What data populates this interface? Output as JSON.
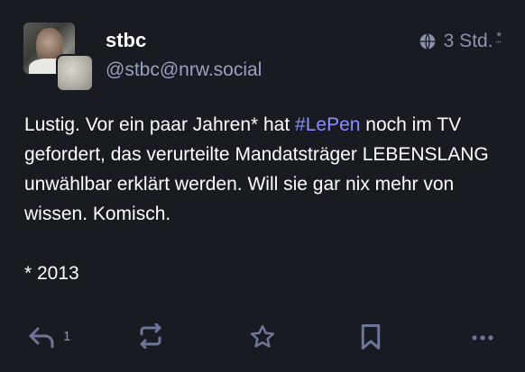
{
  "post": {
    "display_name": "stbc",
    "handle": "@stbc@nrw.social",
    "visibility_icon": "globe-icon",
    "time": "3 Std.",
    "time_marker": "*",
    "content": {
      "line_before_hashtag": "Lustig. Vor ein paar Jahren* hat ",
      "hashtag": "#LePen",
      "line_after_hashtag": " noch im TV gefordert, das verurteilte Mandatsträger LEBENSLANG unwählbar erklärt werden. Will sie gar nix mehr von wissen. Komisch.",
      "footnote": "* 2013"
    }
  },
  "actions": {
    "reply_count": "1",
    "icons": [
      "reply-icon",
      "boost-icon",
      "favourite-icon",
      "bookmark-icon",
      "more-icon"
    ]
  },
  "colors": {
    "background": "#191b22",
    "text": "#ffffff",
    "muted": "#9ba1c3",
    "hashtag": "#8c8dff",
    "icon": "#6f7599"
  }
}
